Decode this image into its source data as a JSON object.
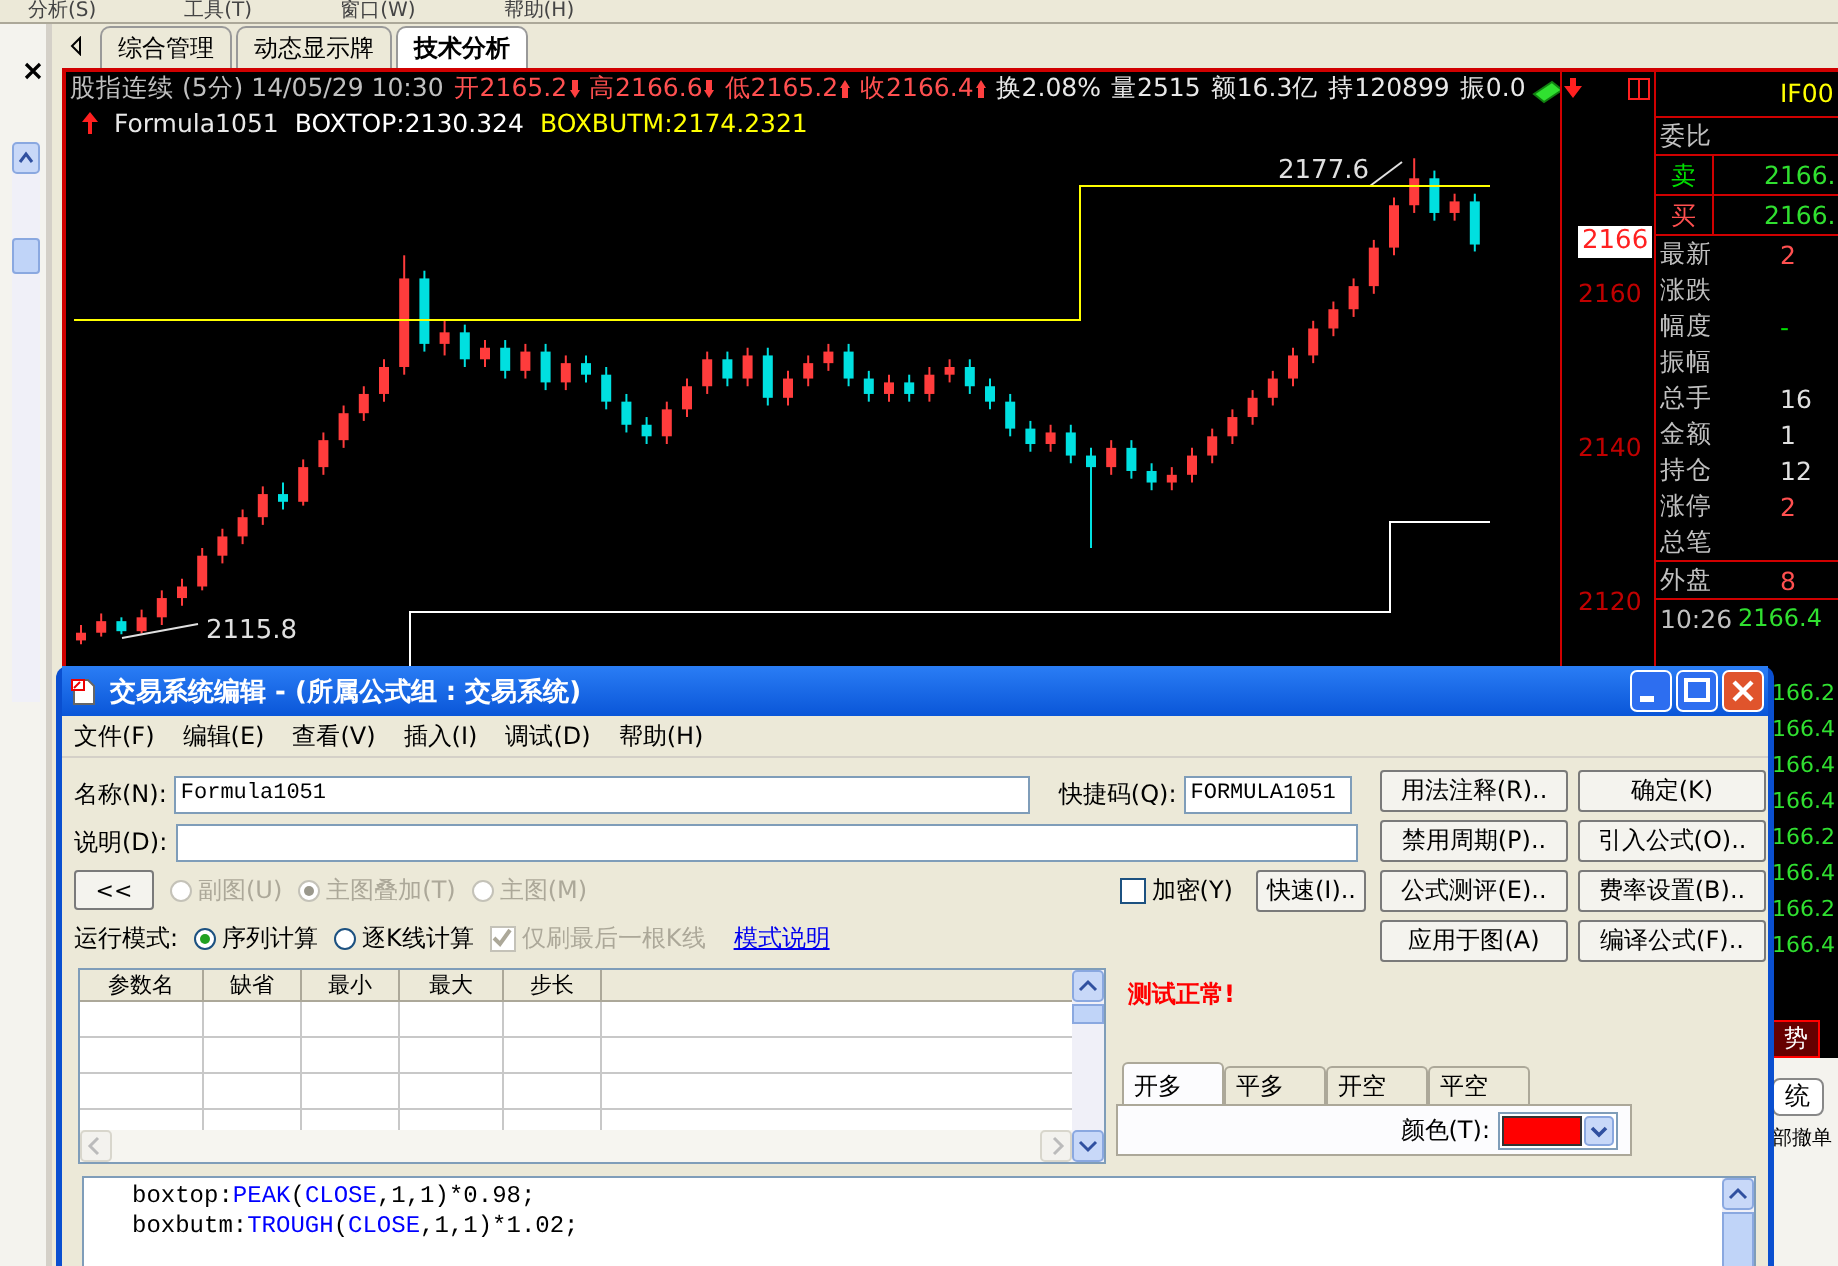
{
  "menu_bar": {
    "items": [
      "分析(S)",
      "工具(T)",
      "窗口(W)",
      "帮助(H)"
    ]
  },
  "tabs": [
    {
      "label": "综合管理",
      "selected": false
    },
    {
      "label": "动态显示牌",
      "selected": false
    },
    {
      "label": "技术分析",
      "selected": true
    }
  ],
  "chart_header": {
    "title": "股指连续 (5分) 14/05/29 10:30",
    "quotes": [
      {
        "text": "开2165.2",
        "kind": "down"
      },
      {
        "text": "高2166.6",
        "kind": "down"
      },
      {
        "text": "低2165.2",
        "kind": "up"
      },
      {
        "text": "收2166.4",
        "kind": "up"
      }
    ],
    "stats": [
      "换2.08%",
      "量2515",
      "额16.3亿",
      "持120899",
      "振0.0"
    ]
  },
  "indicator": {
    "name": "Formula1051",
    "lines": [
      {
        "text": "BOXTOP:2130.324",
        "color": "#ffffff"
      },
      {
        "text": "BOXBUTM:2174.2321",
        "color": "#ffff00"
      }
    ]
  },
  "chart": {
    "high_label": "2177.6",
    "low_label": "2115.8",
    "price_tag": "2166",
    "chart_data": {
      "type": "candlestick",
      "ylim": [
        2110.9,
        2188.8
      ],
      "yticks": [
        2120,
        2140,
        2160
      ],
      "ohlc": [
        [
          2115.0,
          2117.0,
          2114.5,
          2116.0
        ],
        [
          2116.0,
          2118.5,
          2115.5,
          2117.5
        ],
        [
          2117.5,
          2118.0,
          2115.8,
          2116.2
        ],
        [
          2116.2,
          2119.0,
          2115.9,
          2118.0
        ],
        [
          2118.0,
          2121.5,
          2117.0,
          2120.5
        ],
        [
          2120.5,
          2123.0,
          2119.5,
          2122.0
        ],
        [
          2122.0,
          2127.0,
          2121.5,
          2126.0
        ],
        [
          2126.0,
          2129.5,
          2125.0,
          2128.5
        ],
        [
          2128.5,
          2132.0,
          2127.5,
          2131.0
        ],
        [
          2131.0,
          2135.0,
          2130.0,
          2134.0
        ],
        [
          2134.0,
          2135.5,
          2132.0,
          2133.0
        ],
        [
          2133.0,
          2138.5,
          2132.5,
          2137.5
        ],
        [
          2137.5,
          2142.0,
          2136.5,
          2141.0
        ],
        [
          2141.0,
          2145.5,
          2140.0,
          2144.5
        ],
        [
          2144.5,
          2148.0,
          2143.5,
          2147.0
        ],
        [
          2147.0,
          2151.5,
          2146.0,
          2150.5
        ],
        [
          2150.5,
          2165.0,
          2149.5,
          2162.0
        ],
        [
          2162.0,
          2163.0,
          2152.5,
          2153.5
        ],
        [
          2153.5,
          2156.5,
          2152.0,
          2155.0
        ],
        [
          2155.0,
          2156.0,
          2150.5,
          2151.5
        ],
        [
          2151.5,
          2154.0,
          2150.5,
          2153.0
        ],
        [
          2153.0,
          2154.0,
          2149.0,
          2150.0
        ],
        [
          2150.0,
          2153.5,
          2149.0,
          2152.5
        ],
        [
          2152.5,
          2153.5,
          2147.5,
          2148.5
        ],
        [
          2148.5,
          2152.0,
          2147.5,
          2151.0
        ],
        [
          2151.0,
          2152.0,
          2148.5,
          2149.5
        ],
        [
          2149.5,
          2150.5,
          2145.0,
          2146.0
        ],
        [
          2146.0,
          2147.0,
          2142.0,
          2143.0
        ],
        [
          2143.0,
          2144.0,
          2140.5,
          2141.5
        ],
        [
          2141.5,
          2146.0,
          2140.5,
          2145.0
        ],
        [
          2145.0,
          2149.0,
          2144.0,
          2148.0
        ],
        [
          2148.0,
          2152.5,
          2147.0,
          2151.5
        ],
        [
          2151.5,
          2152.5,
          2148.0,
          2149.0
        ],
        [
          2149.0,
          2153.0,
          2148.0,
          2152.0
        ],
        [
          2152.0,
          2153.0,
          2145.5,
          2146.5
        ],
        [
          2146.5,
          2150.0,
          2145.5,
          2149.0
        ],
        [
          2149.0,
          2152.0,
          2148.0,
          2151.0
        ],
        [
          2151.0,
          2153.5,
          2150.0,
          2152.5
        ],
        [
          2152.5,
          2153.5,
          2148.0,
          2149.0
        ],
        [
          2149.0,
          2150.0,
          2146.0,
          2147.0
        ],
        [
          2147.0,
          2149.5,
          2146.0,
          2148.5
        ],
        [
          2148.5,
          2149.5,
          2146.0,
          2147.0
        ],
        [
          2147.0,
          2150.5,
          2146.0,
          2149.5
        ],
        [
          2149.5,
          2151.5,
          2148.5,
          2150.5
        ],
        [
          2150.5,
          2151.5,
          2147.0,
          2148.0
        ],
        [
          2148.0,
          2149.0,
          2145.0,
          2146.0
        ],
        [
          2146.0,
          2147.0,
          2141.5,
          2142.5
        ],
        [
          2142.5,
          2143.5,
          2139.5,
          2140.5
        ],
        [
          2140.5,
          2143.0,
          2139.5,
          2142.0
        ],
        [
          2142.0,
          2143.0,
          2138.0,
          2139.0
        ],
        [
          2139.0,
          2140.0,
          2127.0,
          2137.5
        ],
        [
          2137.5,
          2141.0,
          2136.5,
          2140.0
        ],
        [
          2140.0,
          2141.0,
          2136.0,
          2137.0
        ],
        [
          2137.0,
          2138.0,
          2134.5,
          2135.5
        ],
        [
          2135.5,
          2137.5,
          2134.5,
          2136.5
        ],
        [
          2136.5,
          2140.0,
          2135.5,
          2139.0
        ],
        [
          2139.0,
          2142.5,
          2138.0,
          2141.5
        ],
        [
          2141.5,
          2145.0,
          2140.5,
          2144.0
        ],
        [
          2144.0,
          2147.5,
          2143.0,
          2146.5
        ],
        [
          2146.5,
          2150.0,
          2145.5,
          2149.0
        ],
        [
          2149.0,
          2153.0,
          2148.0,
          2152.0
        ],
        [
          2152.0,
          2156.5,
          2151.0,
          2155.5
        ],
        [
          2155.5,
          2159.0,
          2154.5,
          2158.0
        ],
        [
          2158.0,
          2162.0,
          2157.0,
          2161.0
        ],
        [
          2161.0,
          2167.0,
          2160.0,
          2166.0
        ],
        [
          2166.0,
          2172.5,
          2165.0,
          2171.5
        ],
        [
          2171.5,
          2177.6,
          2170.5,
          2175.0
        ],
        [
          2175.0,
          2176.0,
          2169.5,
          2170.5
        ],
        [
          2170.5,
          2173.0,
          2169.5,
          2172.0
        ],
        [
          2172.0,
          2173.0,
          2165.5,
          2166.4
        ]
      ]
    }
  },
  "quote_panel": {
    "code": "IF00",
    "ratio_label": "委比",
    "sides": [
      {
        "label": "卖",
        "value": "2166.",
        "kind": "sell"
      },
      {
        "label": "买",
        "value": "2166.",
        "kind": "buy"
      }
    ],
    "fields": [
      {
        "label": "最新",
        "value": "2",
        "kind": "up"
      },
      {
        "label": "涨跌"
      },
      {
        "label": "幅度",
        "value": "-",
        "kind": "down"
      },
      {
        "label": "振幅"
      },
      {
        "label": "总手",
        "value": "16",
        "kind": "plain"
      },
      {
        "label": "金额",
        "value": "1",
        "kind": "plain"
      },
      {
        "label": "持仓",
        "value": "12",
        "kind": "plain"
      },
      {
        "label": "涨停",
        "value": "2",
        "kind": "up"
      },
      {
        "label": "总笔"
      }
    ],
    "outer": {
      "label": "外盘",
      "value": "8"
    },
    "tick": {
      "time": "10:26",
      "price": "2166.4"
    },
    "side_prices": [
      "166.2",
      "166.4",
      "166.4",
      "166.4",
      "166.2",
      "166.4",
      "166.2",
      "166.4"
    ],
    "trend_label": "势",
    "system_label": "统",
    "cancel_label": "部撤单"
  },
  "dialog": {
    "title": "交易系统编辑 - (所属公式组 : 交易系统)",
    "menu": [
      "文件(F)",
      "编辑(E)",
      "查看(V)",
      "插入(I)",
      "调试(D)",
      "帮助(H)"
    ],
    "name_label": "名称(N):",
    "name_value": "Formula1051",
    "hotkey_label": "快捷码(Q):",
    "hotkey_value": "FORMULA1051",
    "desc_label": "说明(D):",
    "collapse_button": "<<",
    "display_options": [
      {
        "label": "副图(U)",
        "selected": false,
        "disabled": true
      },
      {
        "label": "主图叠加(T)",
        "selected": true,
        "disabled": true
      },
      {
        "label": "主图(M)",
        "selected": false,
        "disabled": true
      }
    ],
    "encrypt": {
      "label": "加密(Y)",
      "checked": false
    },
    "quick_button": "快速(I)..",
    "run_mode": {
      "label": "运行模式:",
      "options": [
        {
          "label": "序列计算",
          "selected": true
        },
        {
          "label": "逐K线计算",
          "selected": false
        }
      ],
      "refresh_last": {
        "label": "仅刷最后一根K线",
        "checked": true,
        "disabled": true
      },
      "link": "模式说明"
    },
    "buttons": [
      "用法注释(R)..",
      "确定(K)",
      "禁用周期(P)..",
      "引入公式(O)..",
      "公式测评(E)..",
      "费率设置(B)..",
      "应用于图(A)",
      "编译公式(F).."
    ],
    "param_table": {
      "columns": [
        "参数名",
        "缺省",
        "最小",
        "最大",
        "步长"
      ]
    },
    "test_status": "测试正常!",
    "signal_tabs": [
      {
        "label": "开多",
        "selected": true
      },
      {
        "label": "平多",
        "selected": false
      },
      {
        "label": "开空",
        "selected": false
      },
      {
        "label": "平空",
        "selected": false
      }
    ],
    "color_label": "颜色(T):",
    "color": "#ff0000",
    "code": [
      [
        {
          "t": "boxtop:",
          "kind": "plain"
        },
        {
          "t": "PEAK",
          "kind": "func"
        },
        {
          "t": "(",
          "kind": "plain"
        },
        {
          "t": "CLOSE",
          "kind": "func"
        },
        {
          "t": ",1,1)*0.98;",
          "kind": "plain"
        }
      ],
      [
        {
          "t": "boxbutm:",
          "kind": "plain"
        },
        {
          "t": "TROUGH",
          "kind": "func"
        },
        {
          "t": "(",
          "kind": "plain"
        },
        {
          "t": "CLOSE",
          "kind": "func"
        },
        {
          "t": ",1,1)*1.02;",
          "kind": "plain"
        }
      ]
    ]
  }
}
